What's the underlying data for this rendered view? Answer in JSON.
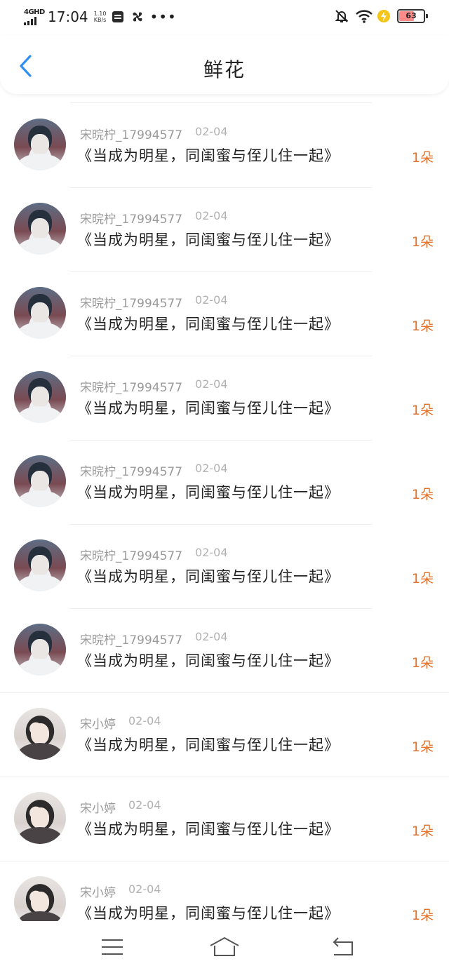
{
  "status_bar": {
    "network": "4GHD",
    "time": "17:04",
    "speed_value": "1.10",
    "speed_unit": "KB/s",
    "battery": "63",
    "battery_level": 0.63,
    "icons": [
      "signal-icon",
      "sim-card-icon",
      "fan-icon",
      "more-dots-icon",
      "mute-bell-icon",
      "wifi-icon",
      "charging-icon",
      "battery-icon"
    ]
  },
  "header": {
    "title": "鲜花",
    "back_icon": "chevron-left-icon",
    "accent": "#2f8ff0"
  },
  "list": {
    "items": [
      {
        "user": "宋晥柠_17994577",
        "date": "02-04",
        "title": "《当成为明星，同闺蜜与侄儿住一起》",
        "count": "1朵"
      },
      {
        "user": "宋晥柠_17994577",
        "date": "02-04",
        "title": "《当成为明星，同闺蜜与侄儿住一起》",
        "count": "1朵"
      },
      {
        "user": "宋晥柠_17994577",
        "date": "02-04",
        "title": "《当成为明星，同闺蜜与侄儿住一起》",
        "count": "1朵"
      },
      {
        "user": "宋晥柠_17994577",
        "date": "02-04",
        "title": "《当成为明星，同闺蜜与侄儿住一起》",
        "count": "1朵"
      },
      {
        "user": "宋晥柠_17994577",
        "date": "02-04",
        "title": "《当成为明星，同闺蜜与侄儿住一起》",
        "count": "1朵"
      },
      {
        "user": "宋晥柠_17994577",
        "date": "02-04",
        "title": "《当成为明星，同闺蜜与侄儿住一起》",
        "count": "1朵"
      },
      {
        "user": "宋晥柠_17994577",
        "date": "02-04",
        "title": "《当成为明星，同闺蜜与侄儿住一起》",
        "count": "1朵"
      },
      {
        "user": "宋小婷",
        "date": "02-04",
        "title": "《当成为明星，同闺蜜与侄儿住一起》",
        "count": "1朵"
      },
      {
        "user": "宋小婷",
        "date": "02-04",
        "title": "《当成为明星，同闺蜜与侄儿住一起》",
        "count": "1朵"
      },
      {
        "user": "宋小婷",
        "date": "02-04",
        "title": "《当成为明星，同闺蜜与侄儿住一起》",
        "count": "1朵"
      }
    ],
    "count_color": "#e2722c"
  },
  "bottom_nav": {
    "icons": [
      "menu-icon",
      "home-icon",
      "back-arrow-icon"
    ]
  }
}
